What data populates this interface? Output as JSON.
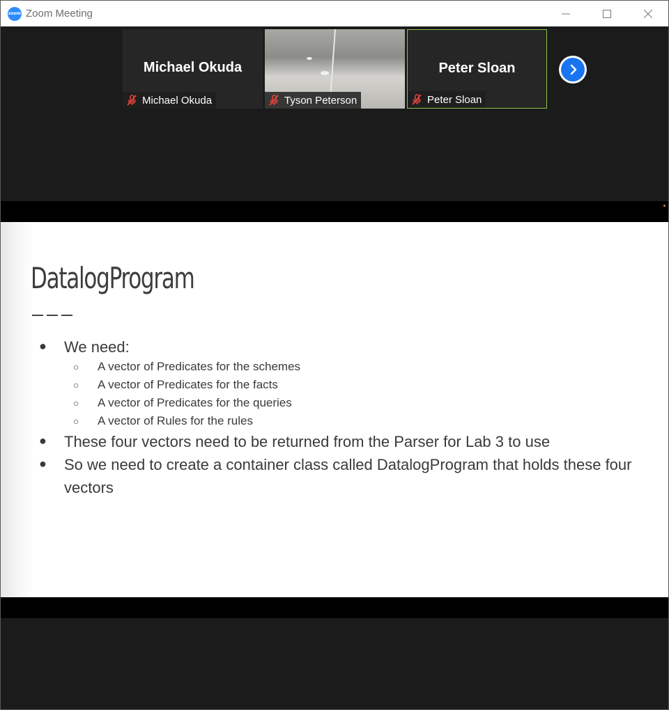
{
  "window": {
    "title": "Zoom Meeting",
    "logo_text": "zoom",
    "controls": [
      "minimize",
      "maximize",
      "close"
    ]
  },
  "gallery": {
    "tiles": [
      {
        "big_name": "Michael Okuda",
        "label": "Michael Okuda",
        "muted": true,
        "video": false,
        "active": false
      },
      {
        "big_name": "",
        "label": "Tyson Peterson",
        "muted": true,
        "video": true,
        "active": false
      },
      {
        "big_name": "Peter Sloan",
        "label": "Peter Sloan",
        "muted": true,
        "video": false,
        "active": true
      }
    ],
    "next_icon": "chevron-right-icon"
  },
  "slide": {
    "title": "DatalogProgram",
    "bullets": [
      {
        "text": "We need:",
        "sub": [
          "A vector of Predicates for the schemes",
          "A vector of Predicates for the facts",
          "A vector of Predicates for the queries",
          "A vector of Rules for the rules"
        ]
      },
      {
        "text": "These four vectors need to be returned from the Parser for Lab 3 to use"
      },
      {
        "text": "So we need to create a container class called DatalogProgram that holds these four vectors"
      }
    ],
    "bullet_glyph": "●",
    "sub_bullet_glyph": "○"
  },
  "colors": {
    "active_speaker_border": "#8bc24a",
    "next_button": "#1a74f0",
    "mute_icon": "#e2443b",
    "zoom_blue": "#2d8cff"
  }
}
